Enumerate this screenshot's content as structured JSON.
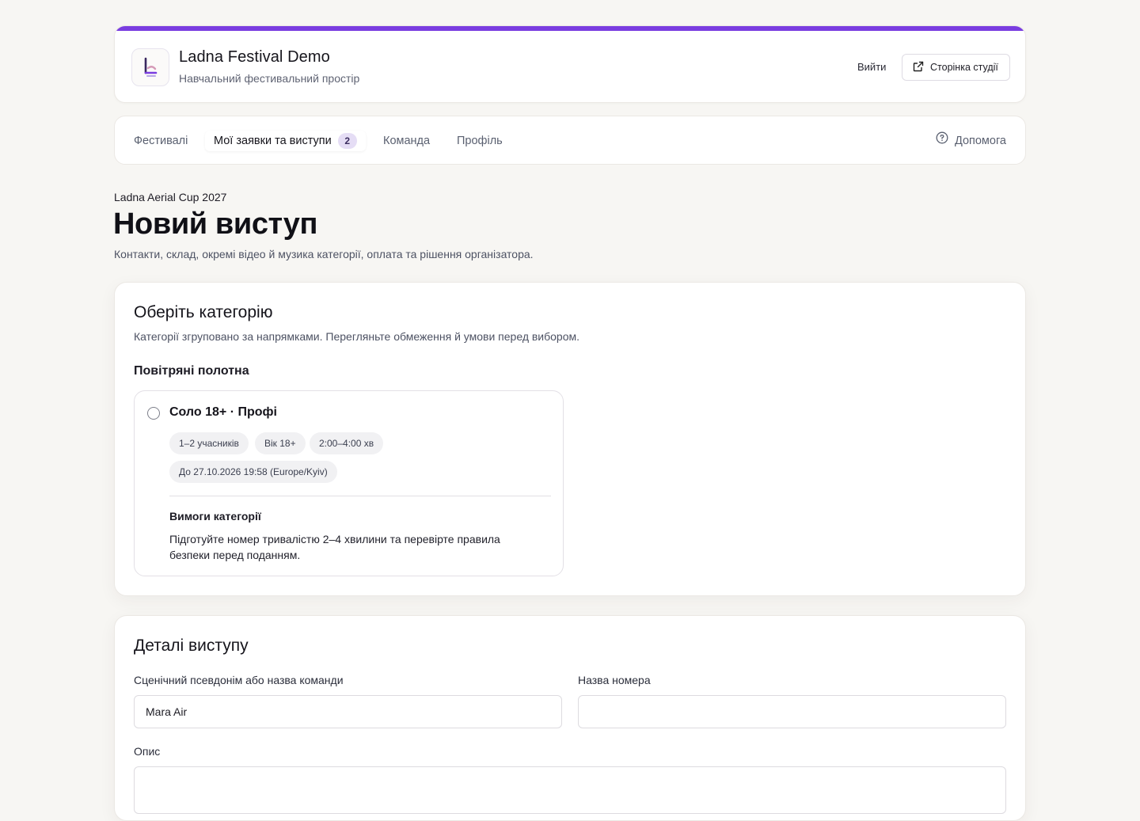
{
  "header": {
    "app_title": "Ladna Festival Demo",
    "app_subtitle": "Навчальний фестивальний простір",
    "logout_label": "Вийти",
    "studio_page_label": "Сторінка студії",
    "accent_color": "#7a3de0"
  },
  "nav": {
    "items": [
      {
        "label": "Фестивалі"
      },
      {
        "label": "Мої заявки та виступи",
        "badge": "2",
        "active": true
      },
      {
        "label": "Команда"
      },
      {
        "label": "Профіль"
      }
    ],
    "help_label": "Допомога"
  },
  "page": {
    "festival_name": "Ladna Aerial Cup 2027",
    "title": "Новий виступ",
    "description": "Контакти, склад, окремі відео й музика категорії, оплата та рішення організатора."
  },
  "category_section": {
    "title": "Оберіть категорію",
    "subtitle": "Категорії згруповано за напрямками. Перегляньте обмеження й умови перед вибором.",
    "group_title": "Повітряні полотна",
    "option": {
      "title": "Соло 18+ · Профі",
      "selected": false,
      "chips": [
        "1–2 учасників",
        "Вік 18+",
        "2:00–4:00 хв",
        "До 27.10.2026 19:58 (Europe/Kyiv)"
      ],
      "requirements_title": "Вимоги категорії",
      "requirements_text": "Підготуйте номер тривалістю 2–4 хвилини та перевірте правила безпеки перед поданням."
    }
  },
  "details_section": {
    "title": "Деталі виступу",
    "stage_name_label": "Сценічний псевдонім або назва команди",
    "stage_name_value": "Mara Air",
    "act_name_label": "Назва номера",
    "act_name_value": "",
    "description_label": "Опис"
  }
}
